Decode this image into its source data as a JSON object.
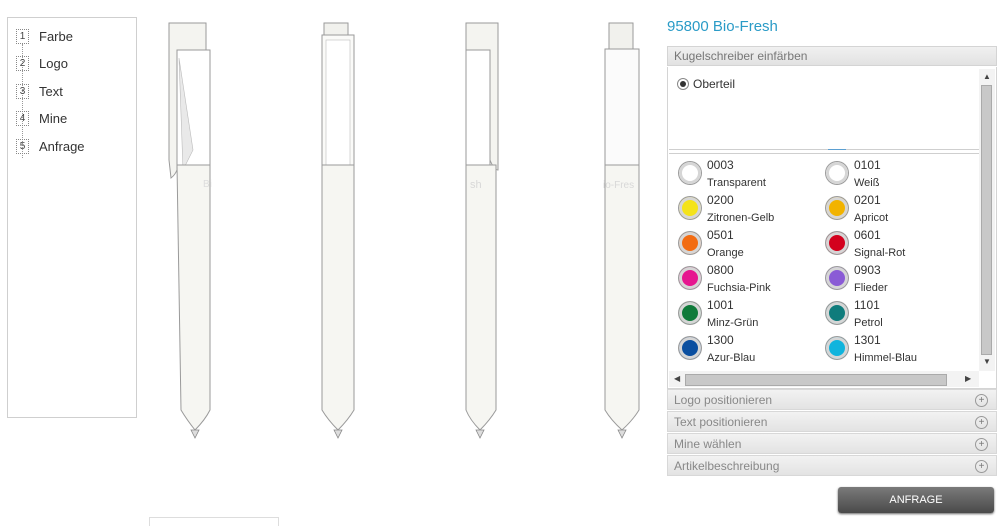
{
  "steps": [
    {
      "num": "1",
      "label": "Farbe"
    },
    {
      "num": "2",
      "label": "Logo"
    },
    {
      "num": "3",
      "label": "Text"
    },
    {
      "num": "4",
      "label": "Mine"
    },
    {
      "num": "5",
      "label": "Anfrage"
    }
  ],
  "product": {
    "title": "95800 Bio-Fresh"
  },
  "config": {
    "section_open": "Kugelschreiber einfärben",
    "part_option": "Oberteil",
    "colors": [
      {
        "code": "0003",
        "name": "Transparent",
        "hex": "#ffffff"
      },
      {
        "code": "0101",
        "name": "Weiß",
        "hex": "#ffffff"
      },
      {
        "code": "0200",
        "name": "Zitronen-Gelb",
        "hex": "#f4e31a"
      },
      {
        "code": "0201",
        "name": "Apricot",
        "hex": "#f2b300"
      },
      {
        "code": "0501",
        "name": "Orange",
        "hex": "#f26b11"
      },
      {
        "code": "0601",
        "name": "Signal-Rot",
        "hex": "#d3001d"
      },
      {
        "code": "0800",
        "name": "Fuchsia-Pink",
        "hex": "#e6168f"
      },
      {
        "code": "0903",
        "name": "Flieder",
        "hex": "#8a5bd6"
      },
      {
        "code": "1001",
        "name": "Minz-Grün",
        "hex": "#0f7a3a"
      },
      {
        "code": "1101",
        "name": "Petrol",
        "hex": "#0f7c7c"
      },
      {
        "code": "1300",
        "name": "Azur-Blau",
        "hex": "#0b4fa0"
      },
      {
        "code": "1301",
        "name": "Himmel-Blau",
        "hex": "#10b4dd"
      }
    ],
    "sections": [
      "Logo positionieren",
      "Text positionieren",
      "Mine wählen",
      "Artikelbeschreibung"
    ]
  },
  "actions": {
    "request_label": "ANFRAGE"
  },
  "pen_labels": {
    "front": "Bio-Fresh",
    "front_short": "Bi",
    "side_right": "sh",
    "right_small": "io-Fres"
  }
}
